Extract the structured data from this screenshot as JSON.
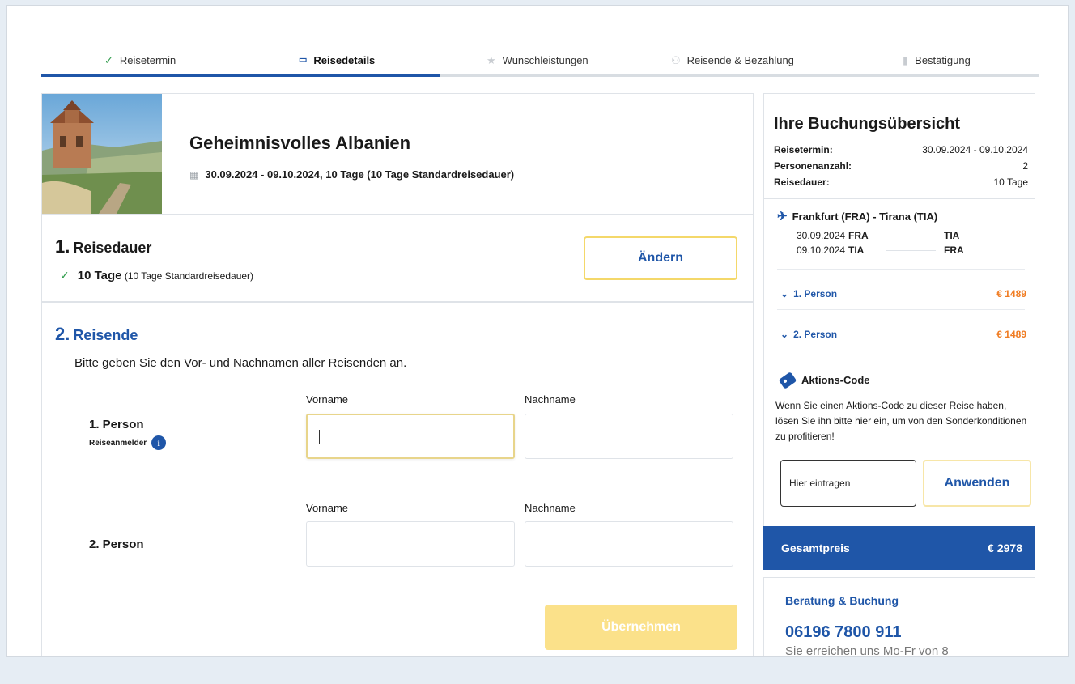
{
  "stepper": {
    "steps": [
      {
        "label": "Reisetermin",
        "icon": "check-icon",
        "state": "done"
      },
      {
        "label": "Reisedetails",
        "icon": "bed-icon",
        "state": "active"
      },
      {
        "label": "Wunschleistungen",
        "icon": "star-icon",
        "state": "todo"
      },
      {
        "label": "Reisende & Bezahlung",
        "icon": "people-icon",
        "state": "todo"
      },
      {
        "label": "Bestätigung",
        "icon": "document-icon",
        "state": "todo"
      }
    ],
    "progress_fraction": 0.4
  },
  "trip": {
    "title": "Geheimnisvolles Albanien",
    "dates": "30.09.2024 - 09.10.2024, 10 Tage (10 Tage Standardreisedauer)"
  },
  "section1": {
    "number": "1.",
    "title": "Reisedauer",
    "value": "10 Tage",
    "note": "(10 Tage Standardreisedauer)",
    "button": "Ändern"
  },
  "section2": {
    "number": "2.",
    "title": "Reisende",
    "description": "Bitte geben Sie den Vor- und Nachnamen aller Reisenden an.",
    "first_name_label": "Vorname",
    "last_name_label": "Nachname",
    "persons": [
      {
        "label": "1. Person",
        "sub": "Reiseanmelder",
        "first_name": "",
        "last_name": ""
      },
      {
        "label": "2. Person",
        "sub": "",
        "first_name": "",
        "last_name": ""
      }
    ],
    "submit": "Übernehmen"
  },
  "summary": {
    "title": "Ihre Buchungsübersicht",
    "rows": [
      {
        "key": "Reisetermin:",
        "value": "30.09.2024 - 09.10.2024"
      },
      {
        "key": "Personenanzahl:",
        "value": "2"
      },
      {
        "key": "Reisedauer:",
        "value": "10 Tage"
      }
    ],
    "flight_title": "Frankfurt (FRA) - Tirana (TIA)",
    "flights": [
      {
        "date": "30.09.2024",
        "from": "FRA",
        "to": "TIA"
      },
      {
        "date": "09.10.2024",
        "from": "TIA",
        "to": "FRA"
      }
    ],
    "persons": [
      {
        "label": "1. Person",
        "price": "€ 1489"
      },
      {
        "label": "2. Person",
        "price": "€ 1489"
      }
    ],
    "promo_title": "Aktions-Code",
    "promo_text": "Wenn Sie einen Aktions-Code zu dieser Reise haben, lösen Sie ihn bitte hier ein, um von den Sonderkonditionen zu profitieren!",
    "promo_placeholder": "Hier eintragen",
    "promo_button": "Anwenden",
    "total_label": "Gesamtpreis",
    "total_value": "€ 2978"
  },
  "contact": {
    "title": "Beratung & Buchung",
    "phone": "06196 7800 911",
    "hours": "Sie erreichen uns Mo-Fr von 8"
  },
  "colors": {
    "brand_blue": "#1f56a8",
    "price_orange": "#f07c22",
    "button_yellow": "#fbe18a",
    "done_green": "#2e9b4a"
  }
}
